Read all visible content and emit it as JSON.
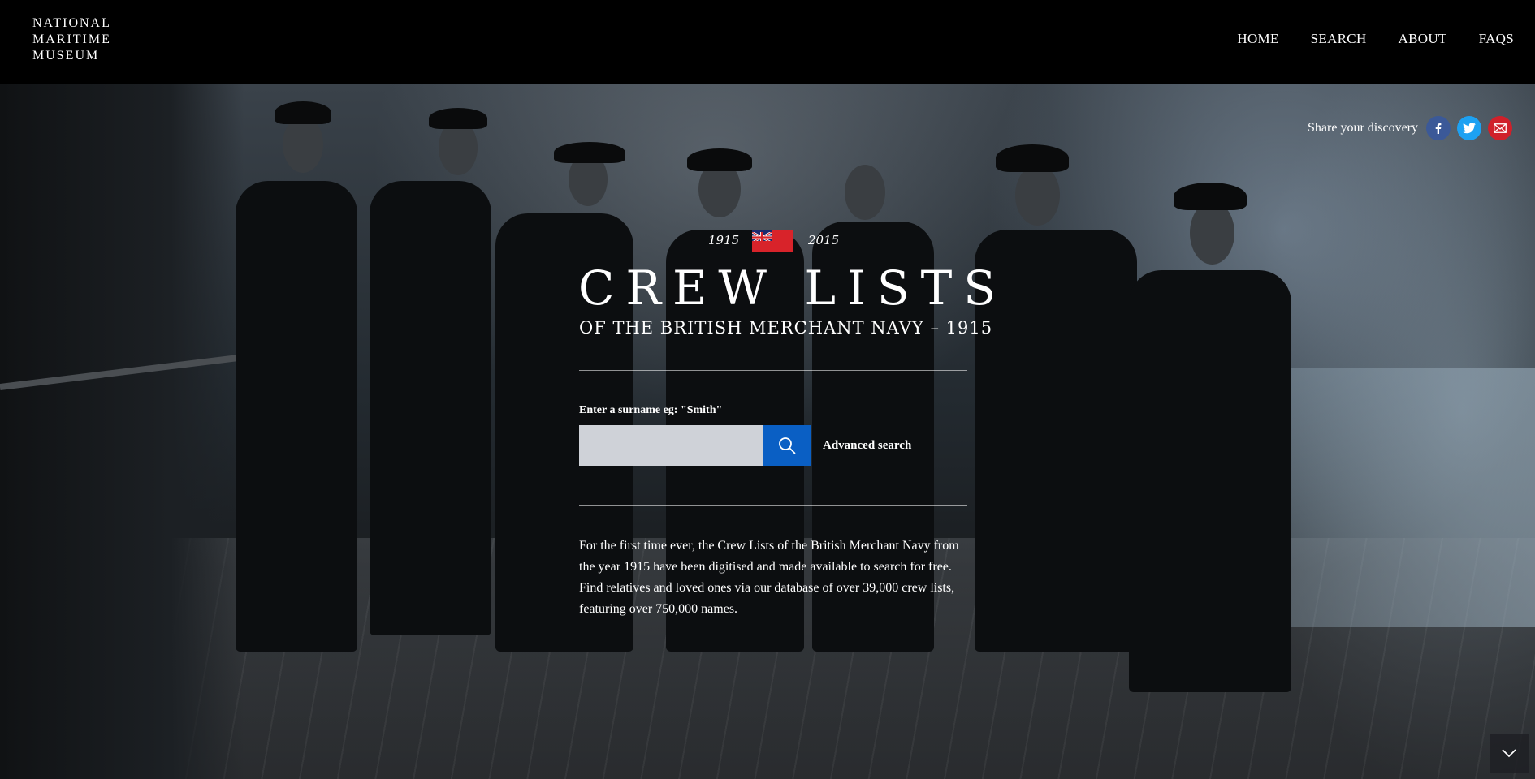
{
  "brand": {
    "logo_lines": [
      "NATIONAL",
      "MARITIME",
      "MUSEUM"
    ]
  },
  "nav": {
    "items": [
      {
        "label": "HOME"
      },
      {
        "label": "SEARCH"
      },
      {
        "label": "ABOUT"
      },
      {
        "label": "FAQS"
      }
    ]
  },
  "share": {
    "label": "Share your discovery",
    "buttons": [
      {
        "icon": "facebook-icon",
        "color": "#3b5998"
      },
      {
        "icon": "twitter-icon",
        "color": "#1da1f2"
      },
      {
        "icon": "email-icon",
        "color": "#d0202a"
      }
    ]
  },
  "hero": {
    "year_start": "1915",
    "year_end": "2015",
    "flag": "red-ensign-flag",
    "title": "CREW LISTS",
    "subtitle": "OF THE BRITISH MERCHANT NAVY – 1915",
    "search": {
      "label": "Enter a surname eg: \"Smith\"",
      "value": "",
      "placeholder": "",
      "button_icon": "search-icon"
    },
    "advanced_search_label": "Advanced search",
    "description": "For the first time ever, the Crew Lists of the British Merchant Navy from the year 1915 have been digitised and made available to search for free. Find relatives and loved ones via our database of over 39,000 crew lists, featuring over 750,000 names."
  },
  "colors": {
    "header_bg": "#000000",
    "search_button": "#0a5fc4",
    "search_input_bg": "#cfd2d8",
    "flag_red": "#d8232a"
  },
  "scroll_icon": "chevron-down-icon"
}
